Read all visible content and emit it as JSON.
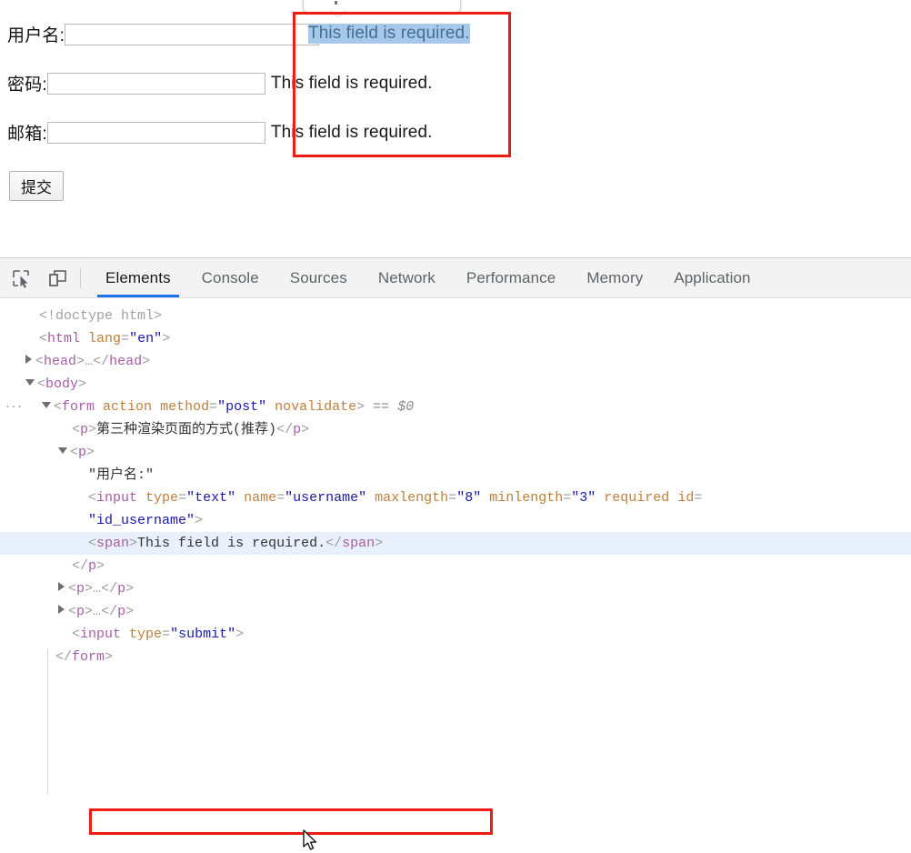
{
  "page": {
    "form": {
      "rows": [
        {
          "label": "用户名:",
          "value": "",
          "error": "This field is required.",
          "selected": true
        },
        {
          "label": "密码:",
          "value": "",
          "error": "This field is required.",
          "selected": false
        },
        {
          "label": "邮箱:",
          "value": "",
          "error": "This field is required.",
          "selected": false
        }
      ],
      "submit_label": "提交"
    },
    "annotation_color": "#ee1c11",
    "selection_highlight_color": "#a8c8ea"
  },
  "devtools": {
    "toolbar": {
      "inspect_icon": "inspect-element-icon",
      "device_icon": "device-toolbar-icon"
    },
    "tabs": [
      {
        "label": "Elements",
        "active": true
      },
      {
        "label": "Console",
        "active": false
      },
      {
        "label": "Sources",
        "active": false
      },
      {
        "label": "Network",
        "active": false
      },
      {
        "label": "Performance",
        "active": false
      },
      {
        "label": "Memory",
        "active": false
      },
      {
        "label": "Application",
        "active": false
      }
    ],
    "active_tab_underline_color": "#1a73e8",
    "dom": {
      "lines": [
        {
          "indent": 1,
          "twisty": "none",
          "badge": "",
          "selected": false,
          "parts": [
            {
              "c": "doctype",
              "t": "<!doctype html>"
            }
          ]
        },
        {
          "indent": 1,
          "twisty": "none",
          "badge": "",
          "selected": false,
          "parts": [
            {
              "c": "punc",
              "t": "<"
            },
            {
              "c": "tag",
              "t": "html"
            },
            {
              "c": "txt",
              "t": " "
            },
            {
              "c": "attr",
              "t": "lang"
            },
            {
              "c": "punc",
              "t": "="
            },
            {
              "c": "val",
              "t": "\"en\""
            },
            {
              "c": "punc",
              "t": ">"
            }
          ]
        },
        {
          "indent": 1,
          "twisty": "closed",
          "badge": "",
          "selected": false,
          "parts": [
            {
              "c": "punc",
              "t": "<"
            },
            {
              "c": "tag",
              "t": "head"
            },
            {
              "c": "punc",
              "t": ">"
            },
            {
              "c": "punc",
              "t": "…"
            },
            {
              "c": "punc",
              "t": "</"
            },
            {
              "c": "tag",
              "t": "head"
            },
            {
              "c": "punc",
              "t": ">"
            }
          ]
        },
        {
          "indent": 1,
          "twisty": "open",
          "badge": "",
          "selected": false,
          "parts": [
            {
              "c": "punc",
              "t": "<"
            },
            {
              "c": "tag",
              "t": "body"
            },
            {
              "c": "punc",
              "t": ">"
            }
          ]
        },
        {
          "indent": 2,
          "twisty": "open",
          "badge": "···",
          "selected": false,
          "parts": [
            {
              "c": "punc",
              "t": "<"
            },
            {
              "c": "tag",
              "t": "form"
            },
            {
              "c": "txt",
              "t": " "
            },
            {
              "c": "attr",
              "t": "action"
            },
            {
              "c": "txt",
              "t": " "
            },
            {
              "c": "attr",
              "t": "method"
            },
            {
              "c": "punc",
              "t": "="
            },
            {
              "c": "val",
              "t": "\"post\""
            },
            {
              "c": "txt",
              "t": " "
            },
            {
              "c": "attr",
              "t": "novalidate"
            },
            {
              "c": "punc",
              "t": ">"
            },
            {
              "c": "eqeq",
              "t": " == "
            },
            {
              "c": "dollar",
              "t": "$0"
            }
          ]
        },
        {
          "indent": 3,
          "twisty": "none",
          "badge": "",
          "selected": false,
          "parts": [
            {
              "c": "punc",
              "t": "<"
            },
            {
              "c": "tag",
              "t": "p"
            },
            {
              "c": "punc",
              "t": ">"
            },
            {
              "c": "txt",
              "t": "第三种渲染页面的方式(推荐)"
            },
            {
              "c": "punc",
              "t": "</"
            },
            {
              "c": "tag",
              "t": "p"
            },
            {
              "c": "punc",
              "t": ">"
            }
          ]
        },
        {
          "indent": 3,
          "twisty": "open",
          "badge": "",
          "selected": false,
          "parts": [
            {
              "c": "punc",
              "t": "<"
            },
            {
              "c": "tag",
              "t": "p"
            },
            {
              "c": "punc",
              "t": ">"
            }
          ]
        },
        {
          "indent": 4,
          "twisty": "none",
          "badge": "",
          "selected": false,
          "parts": [
            {
              "c": "txt",
              "t": "\"用户名:\""
            }
          ]
        },
        {
          "indent": 4,
          "twisty": "none",
          "badge": "",
          "selected": false,
          "parts": [
            {
              "c": "punc",
              "t": "<"
            },
            {
              "c": "tag",
              "t": "input"
            },
            {
              "c": "txt",
              "t": " "
            },
            {
              "c": "attr",
              "t": "type"
            },
            {
              "c": "punc",
              "t": "="
            },
            {
              "c": "val",
              "t": "\"text\""
            },
            {
              "c": "txt",
              "t": " "
            },
            {
              "c": "attr",
              "t": "name"
            },
            {
              "c": "punc",
              "t": "="
            },
            {
              "c": "val",
              "t": "\"username\""
            },
            {
              "c": "txt",
              "t": " "
            },
            {
              "c": "attr",
              "t": "maxlength"
            },
            {
              "c": "punc",
              "t": "="
            },
            {
              "c": "val",
              "t": "\"8\""
            },
            {
              "c": "txt",
              "t": " "
            },
            {
              "c": "attr",
              "t": "minlength"
            },
            {
              "c": "punc",
              "t": "="
            },
            {
              "c": "val",
              "t": "\"3\""
            },
            {
              "c": "txt",
              "t": " "
            },
            {
              "c": "attr",
              "t": "required"
            },
            {
              "c": "txt",
              "t": " "
            },
            {
              "c": "attr",
              "t": "id"
            },
            {
              "c": "punc",
              "t": "="
            }
          ]
        },
        {
          "indent": 4,
          "twisty": "none",
          "badge": "",
          "selected": false,
          "parts": [
            {
              "c": "val",
              "t": "\"id_username\""
            },
            {
              "c": "punc",
              "t": ">"
            }
          ]
        },
        {
          "indent": 4,
          "twisty": "none",
          "badge": "",
          "selected": true,
          "parts": [
            {
              "c": "punc",
              "t": "<"
            },
            {
              "c": "tag",
              "t": "span"
            },
            {
              "c": "punc",
              "t": ">"
            },
            {
              "c": "txt",
              "t": "This field is required."
            },
            {
              "c": "punc",
              "t": "</"
            },
            {
              "c": "tag",
              "t": "span"
            },
            {
              "c": "punc",
              "t": ">"
            }
          ]
        },
        {
          "indent": 3,
          "twisty": "none",
          "badge": "",
          "selected": false,
          "parts": [
            {
              "c": "punc",
              "t": "</"
            },
            {
              "c": "tag",
              "t": "p"
            },
            {
              "c": "punc",
              "t": ">"
            }
          ]
        },
        {
          "indent": 3,
          "twisty": "closed",
          "badge": "",
          "selected": false,
          "parts": [
            {
              "c": "punc",
              "t": "<"
            },
            {
              "c": "tag",
              "t": "p"
            },
            {
              "c": "punc",
              "t": ">"
            },
            {
              "c": "punc",
              "t": "…"
            },
            {
              "c": "punc",
              "t": "</"
            },
            {
              "c": "tag",
              "t": "p"
            },
            {
              "c": "punc",
              "t": ">"
            }
          ]
        },
        {
          "indent": 3,
          "twisty": "closed",
          "badge": "",
          "selected": false,
          "parts": [
            {
              "c": "punc",
              "t": "<"
            },
            {
              "c": "tag",
              "t": "p"
            },
            {
              "c": "punc",
              "t": ">"
            },
            {
              "c": "punc",
              "t": "…"
            },
            {
              "c": "punc",
              "t": "</"
            },
            {
              "c": "tag",
              "t": "p"
            },
            {
              "c": "punc",
              "t": ">"
            }
          ]
        },
        {
          "indent": 3,
          "twisty": "none",
          "badge": "",
          "selected": false,
          "parts": [
            {
              "c": "punc",
              "t": "<"
            },
            {
              "c": "tag",
              "t": "input"
            },
            {
              "c": "txt",
              "t": " "
            },
            {
              "c": "attr",
              "t": "type"
            },
            {
              "c": "punc",
              "t": "="
            },
            {
              "c": "val",
              "t": "\"submit\""
            },
            {
              "c": "punc",
              "t": ">"
            }
          ]
        },
        {
          "indent": 2,
          "twisty": "none",
          "badge": "",
          "selected": false,
          "parts": [
            {
              "c": "punc",
              "t": "</"
            },
            {
              "c": "tag",
              "t": "form"
            },
            {
              "c": "punc",
              "t": ">"
            }
          ]
        }
      ]
    }
  }
}
